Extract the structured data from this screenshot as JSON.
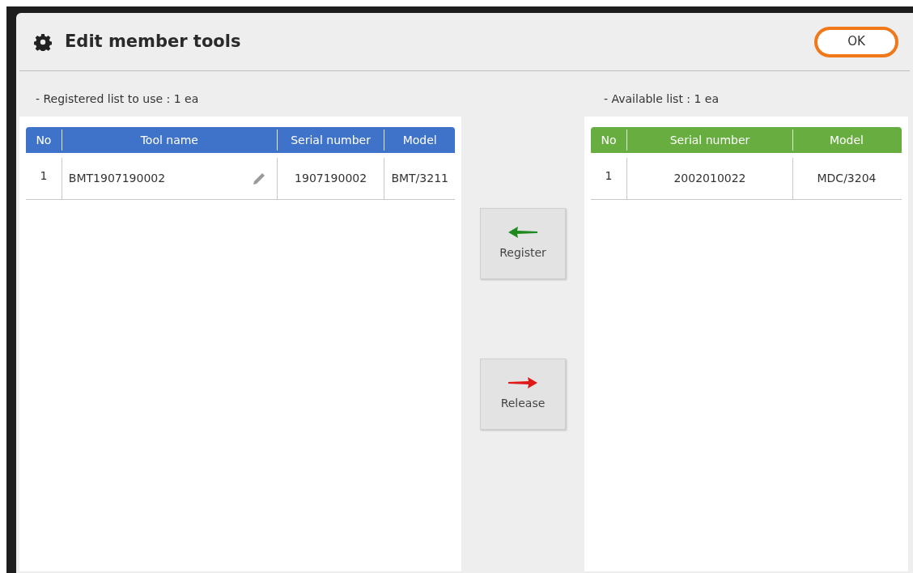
{
  "dialog": {
    "title": "Edit member tools",
    "ok_button": "OK"
  },
  "registered": {
    "label": "- Registered list to use : 1 ea",
    "color": "#3f72c9",
    "columns": [
      {
        "label": "No",
        "kind": "text"
      },
      {
        "label": "Tool name",
        "kind": "editable"
      },
      {
        "label": "Serial number",
        "kind": "text"
      },
      {
        "label": "Model",
        "kind": "text"
      }
    ],
    "rows": [
      [
        "1",
        "BMT1907190002",
        "1907190002",
        "BMT/3211"
      ]
    ]
  },
  "actions": [
    {
      "label": "Register",
      "kind": "left"
    },
    {
      "label": "Release",
      "kind": "right"
    }
  ],
  "available": {
    "label": "- Available list :  1 ea",
    "color": "#67ad3f",
    "columns": [
      {
        "label": "No",
        "kind": "text"
      },
      {
        "label": "Serial number",
        "kind": "text"
      },
      {
        "label": "Model",
        "kind": "text"
      }
    ],
    "rows": [
      [
        "1",
        "2002010022",
        "MDC/3204"
      ]
    ]
  }
}
